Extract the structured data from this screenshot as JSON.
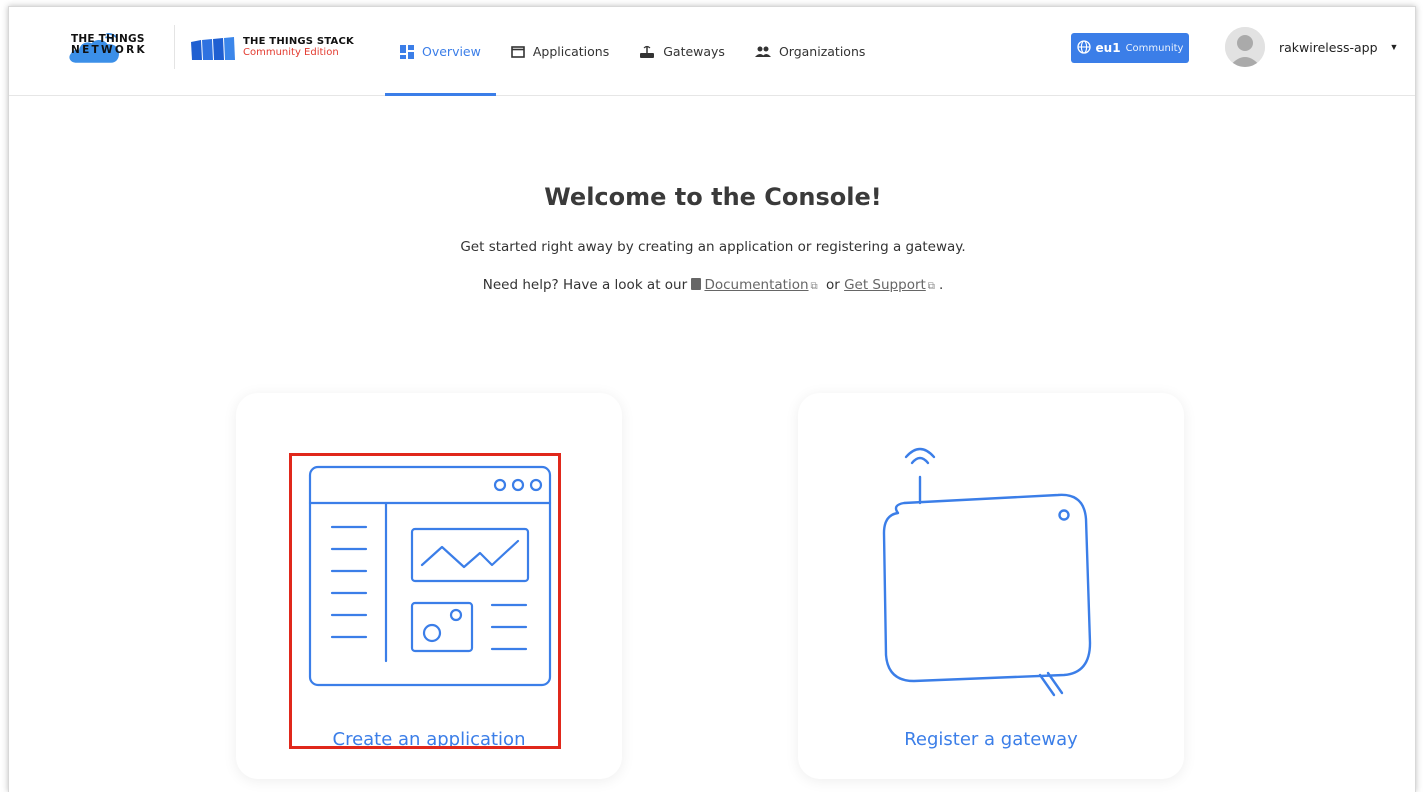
{
  "header": {
    "ttn_logo_line1": "THE THINGS",
    "ttn_logo_line2": "NETWORK",
    "tts_logo_line1": "THE THINGS STACK",
    "tts_logo_line2": "Community Edition",
    "nav": [
      {
        "label": "Overview",
        "icon": "overview-icon",
        "active": true
      },
      {
        "label": "Applications",
        "icon": "application-icon",
        "active": false
      },
      {
        "label": "Gateways",
        "icon": "gateway-icon",
        "active": false
      },
      {
        "label": "Organizations",
        "icon": "organization-icon",
        "active": false
      }
    ],
    "cluster": {
      "region": "eu1",
      "label": "Community"
    },
    "user": {
      "name": "rakwireless-app"
    }
  },
  "main": {
    "title": "Welcome to the Console!",
    "lead": "Get started right away by creating an application or registering a gateway.",
    "help_prefix": "Need help? Have a look at our",
    "documentation_link": "Documentation",
    "or_text": "or",
    "support_link": "Get Support",
    "help_suffix": "."
  },
  "cards": {
    "application_label": "Create an application",
    "gateway_label": "Register a gateway"
  },
  "colors": {
    "accent": "#3b7ee8",
    "brand_red": "#e33b30",
    "highlight": "#e0281b"
  }
}
